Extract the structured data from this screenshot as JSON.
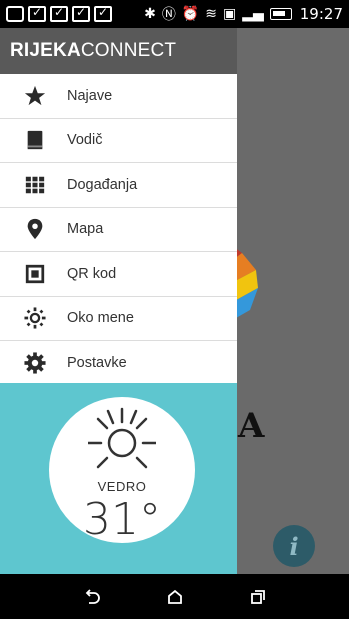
{
  "status_bar": {
    "time": "19:27"
  },
  "app": {
    "title_bold": "RIJEKA",
    "title_light": "CONNECT"
  },
  "menu": {
    "items": [
      {
        "label": "Najave",
        "icon": "star-icon"
      },
      {
        "label": "Vodič",
        "icon": "book-icon"
      },
      {
        "label": "Događanja",
        "icon": "grid-icon"
      },
      {
        "label": "Mapa",
        "icon": "map-pin-icon"
      },
      {
        "label": "QR kod",
        "icon": "qr-code-icon"
      },
      {
        "label": "Oko mene",
        "icon": "location-radius-icon"
      },
      {
        "label": "Postavke",
        "icon": "gear-icon"
      }
    ]
  },
  "weather": {
    "condition": "VEDRO",
    "temperature": "31°"
  },
  "background": {
    "letter": "A",
    "info_label": "i"
  },
  "colors": {
    "header_bg": "#595959",
    "weather_bg": "#5ec6cf",
    "fab_bg": "#2d5b68"
  }
}
